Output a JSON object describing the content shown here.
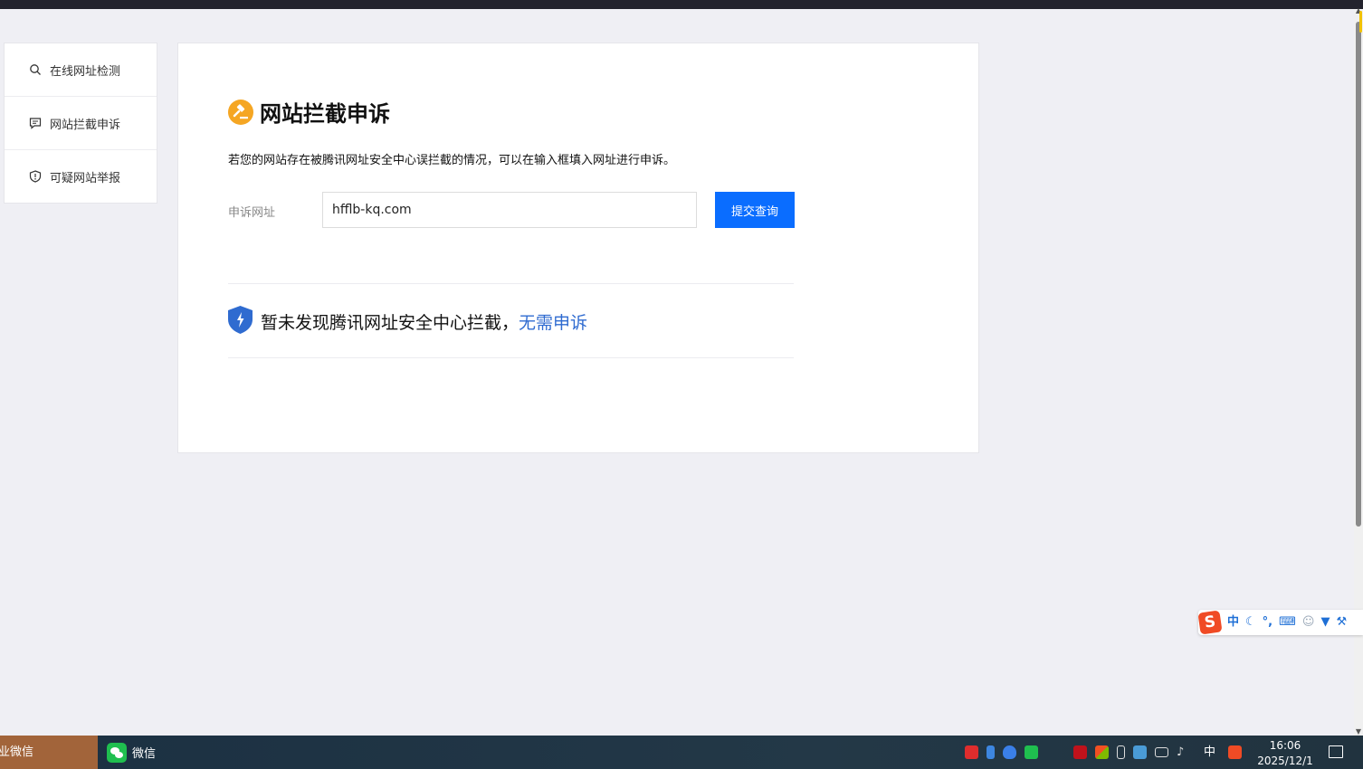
{
  "sidebar": {
    "items": [
      {
        "label": "在线网址检测",
        "icon": "search-icon"
      },
      {
        "label": "网站拦截申诉",
        "icon": "comment-icon"
      },
      {
        "label": "可疑网站举报",
        "icon": "shield-icon"
      }
    ]
  },
  "main": {
    "title": "网站拦截申诉",
    "description": "若您的网站存在被腾讯网址安全中心误拦截的情况，可以在输入框填入网址进行申诉。",
    "form": {
      "label": "申诉网址",
      "url_value": "hfflb-kq.com",
      "submit_label": "提交查询"
    },
    "result": {
      "message": "暂未发现腾讯网址安全中心拦截，",
      "link_text": "无需申诉"
    }
  },
  "ime_bar": {
    "logo": "S",
    "mode": "中",
    "punct": "°,"
  },
  "taskbar": {
    "left_app": "业微信",
    "wechat_label": "微信",
    "lang": "中",
    "time": "16:06",
    "date": "2025/12/1"
  },
  "colors": {
    "accent_blue": "#0a6dff",
    "link_blue": "#2f6bd0",
    "title_badge": "#f5a623",
    "shield_blue": "#2f6bd0"
  }
}
